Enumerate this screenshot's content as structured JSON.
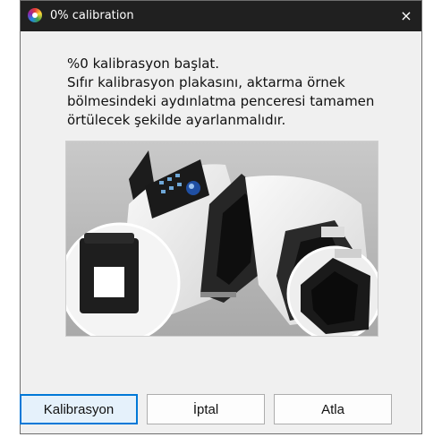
{
  "window": {
    "title": "0% calibration",
    "close_glyph": "×",
    "icon": "color-wheel-icon"
  },
  "message": {
    "line1": "%0 kalibrasyon başlat.",
    "line2": "Sıfır kalibrasyon plakasını, aktarma örnek",
    "line3": "bölmesindeki aydınlatma penceresi tamamen",
    "line4": "örtülecek şekilde ayarlanmalıdır."
  },
  "buttons": {
    "calibrate": "Kalibrasyon",
    "cancel": "İptal",
    "skip": "Atla"
  },
  "colors": {
    "titlebar": "#202020",
    "dialog_bg": "#f0f0f0",
    "focus_border": "#0078d7"
  }
}
